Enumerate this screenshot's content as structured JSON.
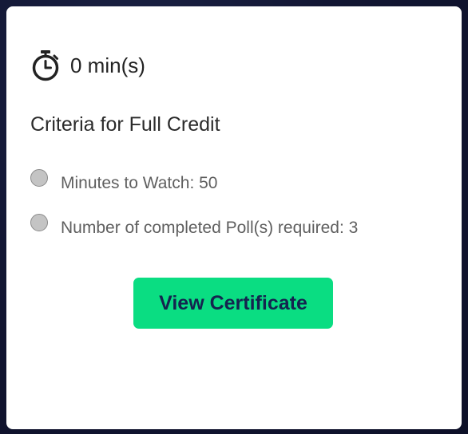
{
  "timer": {
    "icon": "stopwatch-icon",
    "value": "0 min(s)"
  },
  "criteria": {
    "title": "Criteria for Full Credit",
    "items": [
      {
        "label": "Minutes to Watch: 50",
        "icon": "radio-circle-icon"
      },
      {
        "label": "Number of completed Poll(s) required: 3",
        "icon": "radio-circle-icon"
      }
    ]
  },
  "actions": {
    "view_certificate_label": "View Certificate"
  },
  "colors": {
    "button_bg": "#0add82",
    "button_text": "#14244f",
    "background": "#121633",
    "card": "#ffffff"
  }
}
